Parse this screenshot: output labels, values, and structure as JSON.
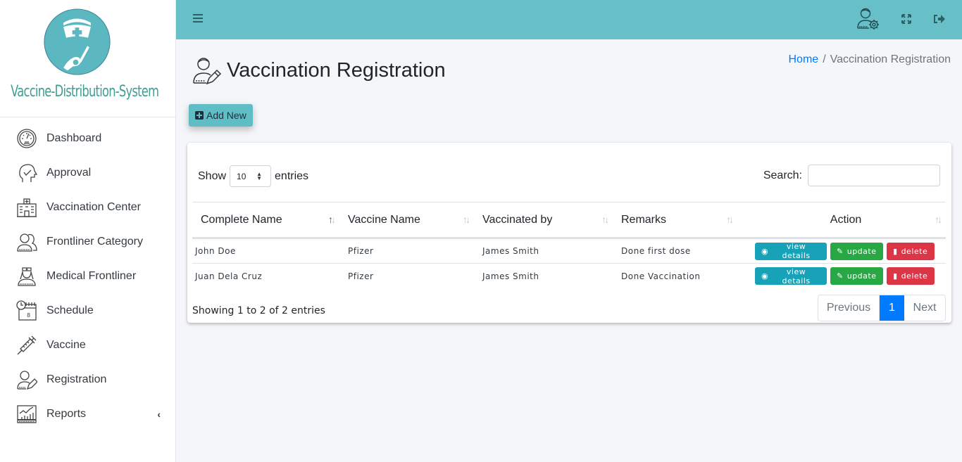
{
  "brand": {
    "name": "Vaccine-Distribution-System",
    "logo_color": "#5bb8c0"
  },
  "sidebar": {
    "items": [
      {
        "label": "Dashboard",
        "icon": "speedometer-icon"
      },
      {
        "label": "Approval",
        "icon": "head-check-icon"
      },
      {
        "label": "Vaccination Center",
        "icon": "hospital-icon"
      },
      {
        "label": "Frontliner Category",
        "icon": "users-icon"
      },
      {
        "label": "Medical Frontliner",
        "icon": "nurse-icon"
      },
      {
        "label": "Schedule",
        "icon": "calendar-clock-icon"
      },
      {
        "label": "Vaccine",
        "icon": "syringe-icon"
      },
      {
        "label": "Registration",
        "icon": "user-edit-icon"
      },
      {
        "label": "Reports",
        "icon": "chart-report-icon",
        "has_submenu": true
      }
    ]
  },
  "topbar": {
    "color": "#67c0c8",
    "icons": [
      "menu-icon",
      "user-settings-icon",
      "fullscreen-icon",
      "logout-icon"
    ]
  },
  "page": {
    "title": "Vaccination Registration",
    "breadcrumb": {
      "home": "Home",
      "separator": "/",
      "current": "Vaccination Registration"
    },
    "add_button": "Add New"
  },
  "table_controls": {
    "show_label": "Show",
    "entries_label": "entries",
    "page_size": "10",
    "search_label": "Search:",
    "search_value": ""
  },
  "table": {
    "columns": [
      "Complete Name",
      "Vaccine Name",
      "Vaccinated by",
      "Remarks",
      "Action"
    ],
    "rows": [
      {
        "name": "John Doe",
        "vaccine": "Pfizer",
        "vaccinated_by": "James Smith",
        "remarks": "Done first dose"
      },
      {
        "name": "Juan Dela Cruz",
        "vaccine": "Pfizer",
        "vaccinated_by": "James Smith",
        "remarks": "Done Vaccination"
      }
    ],
    "actions": {
      "view": "view details",
      "update": "update",
      "delete": "delete"
    }
  },
  "footer": {
    "info": "Showing 1 to 2 of 2 entries",
    "pagination": {
      "previous": "Previous",
      "current": "1",
      "next": "Next"
    }
  }
}
